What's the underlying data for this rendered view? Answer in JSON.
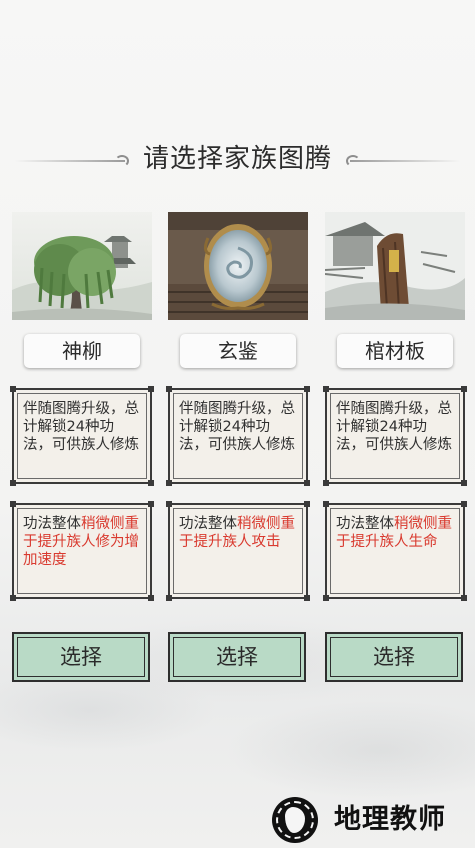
{
  "title": "请选择家族图腾",
  "totems": [
    {
      "name": "神柳",
      "art_icon": "willow-tree-icon",
      "desc": "伴随图腾升级，总计解锁24种功法，可供族人修炼",
      "detail_prefix": "功法整体",
      "detail_highlight": "稍微侧重于提升族人修为增加速度",
      "button": "选择"
    },
    {
      "name": "玄鉴",
      "art_icon": "mirror-icon",
      "desc": "伴随图腾升级，总计解锁24种功法，可供族人修炼",
      "detail_prefix": "功法整体",
      "detail_highlight": "稍微侧重于提升族人攻击",
      "button": "选择"
    },
    {
      "name": "棺材板",
      "art_icon": "coffin-board-icon",
      "desc": "伴随图腾升级，总计解锁24种功法，可供族人修炼",
      "detail_prefix": "功法整体",
      "detail_highlight": "稍微侧重于提升族人生命",
      "button": "选择"
    }
  ],
  "watermark": {
    "text": "地理教师",
    "logo_icon": "globe-seal-icon"
  },
  "colors": {
    "highlight": "#d93a2f",
    "button_bg": "#b9dac6",
    "panel_bg": "#f3f0ea"
  }
}
